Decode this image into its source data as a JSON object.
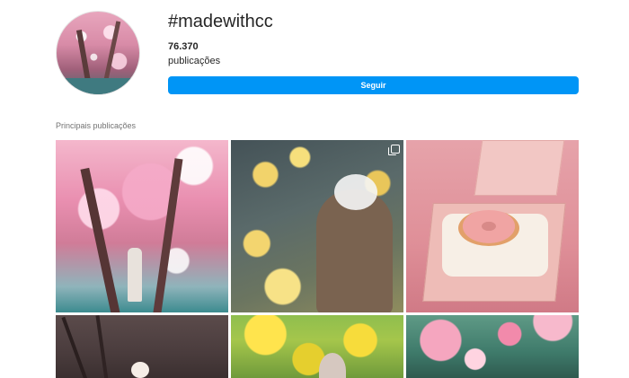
{
  "profile": {
    "hashtag": "#madewithcc",
    "post_count": "76.370",
    "post_label": "publicações",
    "follow_label": "Seguir"
  },
  "section": {
    "title": "Principais publicações"
  },
  "posts": [
    {
      "name": "plum-blossom-tree-photo",
      "multi": false
    },
    {
      "name": "woman-yellow-flowers-photo",
      "multi": true
    },
    {
      "name": "donut-box-photo",
      "multi": false
    },
    {
      "name": "dark-branch-bloom-photo",
      "multi": false
    },
    {
      "name": "yellow-field-figure-photo",
      "multi": false
    },
    {
      "name": "pink-blossoms-photo",
      "multi": false
    }
  ],
  "colors": {
    "accent": "#0095f6",
    "text": "#262626",
    "muted": "#737373"
  }
}
